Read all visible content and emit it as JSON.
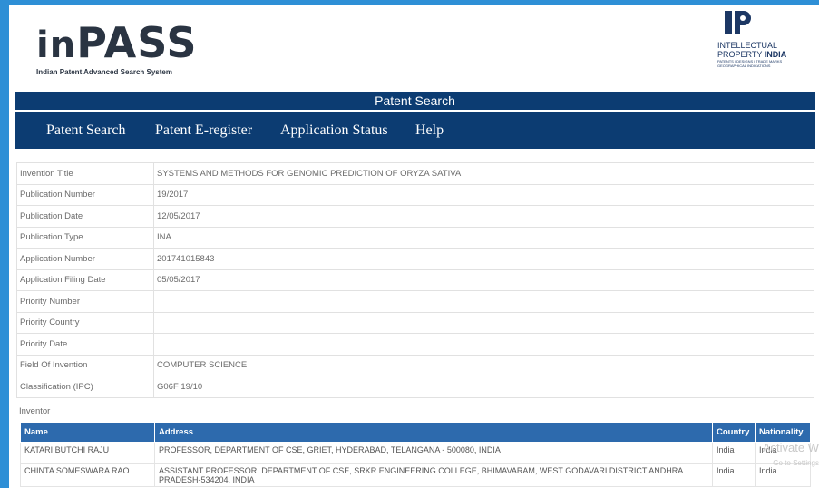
{
  "logo": {
    "name_prefix": "in",
    "name_main": "PASS",
    "subtitle": "Indian Patent Advanced Search System"
  },
  "ipi_logo": {
    "line1": "INTELLECTUAL",
    "line2a": "PROPERTY ",
    "line2b": "INDIA",
    "line3": "PATENTS | DESIGNS | TRADE MARKS",
    "line4": "GEOGRAPHICAL INDICATIONS"
  },
  "titlebar": {
    "title": "Patent Search"
  },
  "nav": {
    "item1": "Patent Search",
    "item2": "Patent E-register",
    "item3": "Application Status",
    "item4": "Help"
  },
  "details": [
    {
      "label": "Invention Title",
      "value": "SYSTEMS AND METHODS FOR GENOMIC PREDICTION OF ORYZA SATIVA"
    },
    {
      "label": "Publication Number",
      "value": "19/2017"
    },
    {
      "label": "Publication Date",
      "value": "12/05/2017"
    },
    {
      "label": "Publication Type",
      "value": "INA"
    },
    {
      "label": "Application Number",
      "value": "201741015843"
    },
    {
      "label": "Application Filing Date",
      "value": "05/05/2017"
    },
    {
      "label": "Priority Number",
      "value": ""
    },
    {
      "label": "Priority Country",
      "value": ""
    },
    {
      "label": "Priority Date",
      "value": ""
    },
    {
      "label": "Field Of Invention",
      "value": "COMPUTER SCIENCE"
    },
    {
      "label": "Classification (IPC)",
      "value": "G06F 19/10"
    }
  ],
  "inventor_label": "Inventor",
  "inventor_table": {
    "headers": {
      "name": "Name",
      "address": "Address",
      "country": "Country",
      "nationality": "Nationality"
    },
    "rows": [
      {
        "name": "KATARI BUTCHI RAJU",
        "address": "PROFESSOR, DEPARTMENT OF CSE, GRIET, HYDERABAD, TELANGANA - 500080, INDIA",
        "country": "India",
        "nationality": "India"
      },
      {
        "name": "CHINTA SOMESWARA RAO",
        "address": "ASSISTANT PROFESSOR, DEPARTMENT OF CSE, SRKR ENGINEERING COLLEGE, BHIMAVARAM, WEST GODAVARI DISTRICT ANDHRA PRADESH-534204, INDIA",
        "country": "India",
        "nationality": "India"
      }
    ]
  },
  "watermark": {
    "line1": "Activate W",
    "line2": "Go to Settings"
  },
  "colors": {
    "navy": "#0c3c72",
    "table_header": "#2d6aad",
    "frame": "#2e8fd6"
  }
}
